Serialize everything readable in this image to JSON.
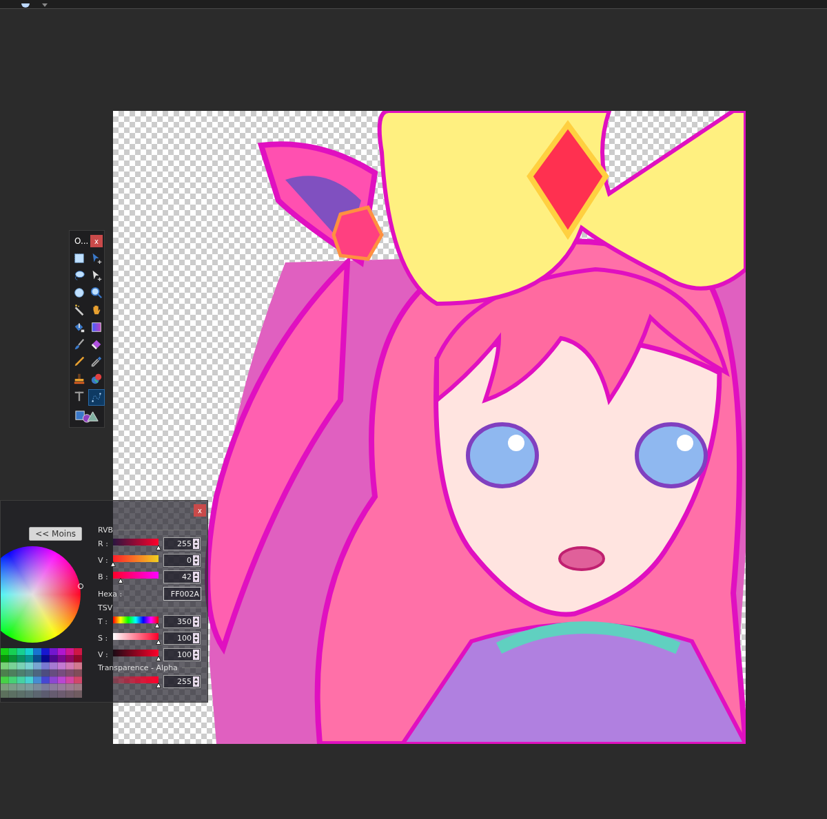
{
  "tools_window": {
    "title": "O...",
    "close": "x",
    "tools": [
      {
        "kind": "rect-select",
        "selected": false
      },
      {
        "kind": "move-selection",
        "selected": false
      },
      {
        "kind": "lasso",
        "selected": false
      },
      {
        "kind": "move-selected",
        "selected": false
      },
      {
        "kind": "ellipse-select",
        "selected": false
      },
      {
        "kind": "zoom",
        "selected": false
      },
      {
        "kind": "magic-wand",
        "selected": false
      },
      {
        "kind": "pan",
        "selected": false
      },
      {
        "kind": "fill",
        "selected": false
      },
      {
        "kind": "gradient",
        "selected": false
      },
      {
        "kind": "brush",
        "selected": false
      },
      {
        "kind": "eraser",
        "selected": false
      },
      {
        "kind": "pencil",
        "selected": false
      },
      {
        "kind": "color-picker",
        "selected": false
      },
      {
        "kind": "stamp",
        "selected": false
      },
      {
        "kind": "recolor",
        "selected": false
      },
      {
        "kind": "text",
        "selected": false
      },
      {
        "kind": "curve",
        "selected": true
      },
      {
        "kind": "shapes",
        "selected": false
      }
    ]
  },
  "colors_window": {
    "close": "x",
    "less_button": "<< Moins",
    "rgb": {
      "heading": "RVB",
      "rows": [
        {
          "kind": "r",
          "label": "R :",
          "level": 1,
          "value": "255"
        },
        {
          "kind": "g",
          "label": "V :",
          "level": 0,
          "value": "0"
        },
        {
          "kind": "b",
          "label": "B :",
          "level": 0.165,
          "value": "42"
        }
      ]
    },
    "hex": {
      "label": "Hexa :",
      "value": "FF002A"
    },
    "hsv": {
      "heading": "TSV",
      "rows": [
        {
          "kind": "h",
          "label": "T :",
          "level": 0.972,
          "value": "350"
        },
        {
          "kind": "s",
          "label": "S :",
          "level": 1,
          "value": "100"
        },
        {
          "kind": "v",
          "label": "V :",
          "level": 1,
          "value": "100"
        }
      ]
    },
    "alpha": {
      "heading": "Transparence - Alpha",
      "rows": [
        {
          "kind": "a",
          "label": "",
          "level": 1,
          "value": "255"
        }
      ]
    }
  }
}
